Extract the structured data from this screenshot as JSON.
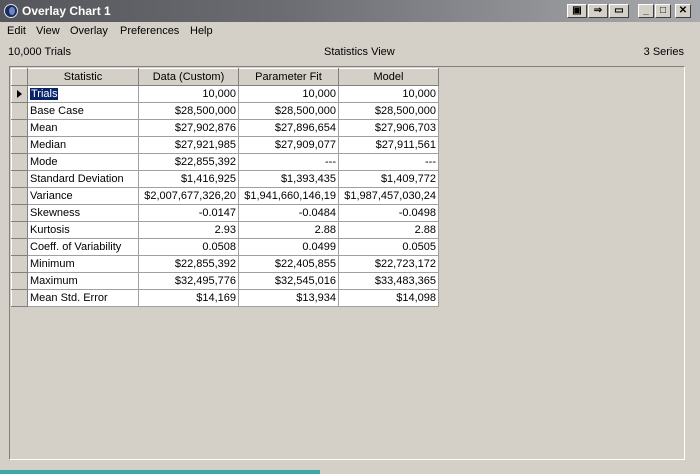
{
  "window": {
    "title": "Overlay Chart 1",
    "buttons": {
      "toolbar_a": "▣",
      "toolbar_b": "⇒",
      "toolbar_c": "▭",
      "minimize": "_",
      "maximize": "□",
      "close": "✕"
    }
  },
  "menu": [
    "Edit",
    "View",
    "Overlay",
    "Preferences",
    "Help"
  ],
  "info": {
    "left": "10,000 Trials",
    "center": "Statistics View",
    "right": "3 Series"
  },
  "table": {
    "columns": [
      "Statistic",
      "Data (Custom)",
      "Parameter Fit",
      "Model"
    ],
    "rows": [
      {
        "label": "Trials",
        "values": [
          "10,000",
          "10,000",
          "10,000"
        ]
      },
      {
        "label": "Base Case",
        "values": [
          "$28,500,000",
          "$28,500,000",
          "$28,500,000"
        ]
      },
      {
        "label": "Mean",
        "values": [
          "$27,902,876",
          "$27,896,654",
          "$27,906,703"
        ]
      },
      {
        "label": "Median",
        "values": [
          "$27,921,985",
          "$27,909,077",
          "$27,911,561"
        ]
      },
      {
        "label": "Mode",
        "values": [
          "$22,855,392",
          "---",
          "---"
        ]
      },
      {
        "label": "Standard Deviation",
        "values": [
          "$1,416,925",
          "$1,393,435",
          "$1,409,772"
        ]
      },
      {
        "label": "Variance",
        "values": [
          "$2,007,677,326,20",
          "$1,941,660,146,19",
          "$1,987,457,030,24"
        ]
      },
      {
        "label": "Skewness",
        "values": [
          "-0.0147",
          "-0.0484",
          "-0.0498"
        ]
      },
      {
        "label": "Kurtosis",
        "values": [
          "2.93",
          "2.88",
          "2.88"
        ]
      },
      {
        "label": "Coeff. of Variability",
        "values": [
          "0.0508",
          "0.0499",
          "0.0505"
        ]
      },
      {
        "label": "Minimum",
        "values": [
          "$22,855,392",
          "$22,405,855",
          "$22,723,172"
        ]
      },
      {
        "label": "Maximum",
        "values": [
          "$32,495,776",
          "$32,545,016",
          "$33,483,365"
        ]
      },
      {
        "label": "Mean Std. Error",
        "values": [
          "$14,169",
          "$13,934",
          "$14,098"
        ]
      }
    ]
  }
}
